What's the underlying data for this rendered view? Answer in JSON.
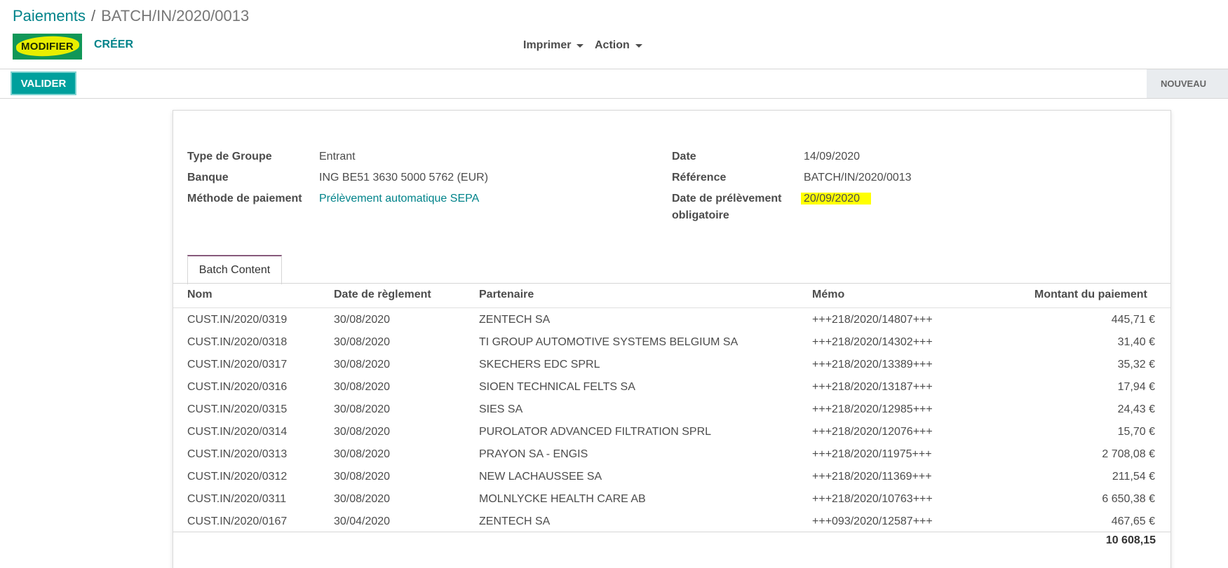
{
  "breadcrumb": {
    "parent": "Paiements",
    "separator": "/",
    "current": "BATCH/IN/2020/0013"
  },
  "buttons": {
    "modifier": "MODIFIER",
    "creer": "CRÉER",
    "valider": "VALIDER"
  },
  "menus": {
    "imprimer": "Imprimer",
    "action": "Action"
  },
  "status": {
    "current": "NOUVEAU"
  },
  "form": {
    "type_label": "Type de Groupe",
    "type_value": "Entrant",
    "banque_label": "Banque",
    "banque_value": "ING BE51 3630 5000 5762 (EUR)",
    "methode_label": "Méthode de paiement",
    "methode_value": "Prélèvement automatique SEPA",
    "date_label": "Date",
    "date_value": "14/09/2020",
    "reference_label": "Référence",
    "reference_value": "BATCH/IN/2020/0013",
    "prelevement_label_1": "Date de prélèvement",
    "prelevement_label_2": "obligatoire",
    "prelevement_value": "20/09/2020"
  },
  "tabs": {
    "batch_content": "Batch Content"
  },
  "table": {
    "headers": {
      "nom": "Nom",
      "date": "Date de règlement",
      "partenaire": "Partenaire",
      "memo": "Mémo",
      "montant": "Montant du paiement"
    },
    "rows": [
      {
        "nom": "CUST.IN/2020/0319",
        "date": "30/08/2020",
        "partenaire": "ZENTECH SA",
        "memo": "+++218/2020/14807+++",
        "montant": "445,71 €"
      },
      {
        "nom": "CUST.IN/2020/0318",
        "date": "30/08/2020",
        "partenaire": "TI GROUP AUTOMOTIVE SYSTEMS BELGIUM SA",
        "memo": "+++218/2020/14302+++",
        "montant": "31,40 €"
      },
      {
        "nom": "CUST.IN/2020/0317",
        "date": "30/08/2020",
        "partenaire": "SKECHERS EDC SPRL",
        "memo": "+++218/2020/13389+++",
        "montant": "35,32 €"
      },
      {
        "nom": "CUST.IN/2020/0316",
        "date": "30/08/2020",
        "partenaire": "SIOEN TECHNICAL FELTS SA",
        "memo": "+++218/2020/13187+++",
        "montant": "17,94 €"
      },
      {
        "nom": "CUST.IN/2020/0315",
        "date": "30/08/2020",
        "partenaire": "SIES SA",
        "memo": "+++218/2020/12985+++",
        "montant": "24,43 €"
      },
      {
        "nom": "CUST.IN/2020/0314",
        "date": "30/08/2020",
        "partenaire": "PUROLATOR ADVANCED FILTRATION SPRL",
        "memo": "+++218/2020/12076+++",
        "montant": "15,70 €"
      },
      {
        "nom": "CUST.IN/2020/0313",
        "date": "30/08/2020",
        "partenaire": "PRAYON SA - ENGIS",
        "memo": "+++218/2020/11975+++",
        "montant": "2 708,08 €"
      },
      {
        "nom": "CUST.IN/2020/0312",
        "date": "30/08/2020",
        "partenaire": "NEW LACHAUSSEE SA",
        "memo": "+++218/2020/11369+++",
        "montant": "211,54 €"
      },
      {
        "nom": "CUST.IN/2020/0311",
        "date": "30/08/2020",
        "partenaire": "MOLNLYCKE HEALTH CARE AB",
        "memo": "+++218/2020/10763+++",
        "montant": "6 650,38 €"
      },
      {
        "nom": "CUST.IN/2020/0167",
        "date": "30/04/2020",
        "partenaire": "ZENTECH SA",
        "memo": "+++093/2020/12587+++",
        "montant": "467,65 €"
      }
    ],
    "total": "10 608,15"
  },
  "colors": {
    "primary": "#00a09d",
    "link": "#00838a",
    "highlight": "#ffff00",
    "tab_accent": "#875a7b"
  }
}
